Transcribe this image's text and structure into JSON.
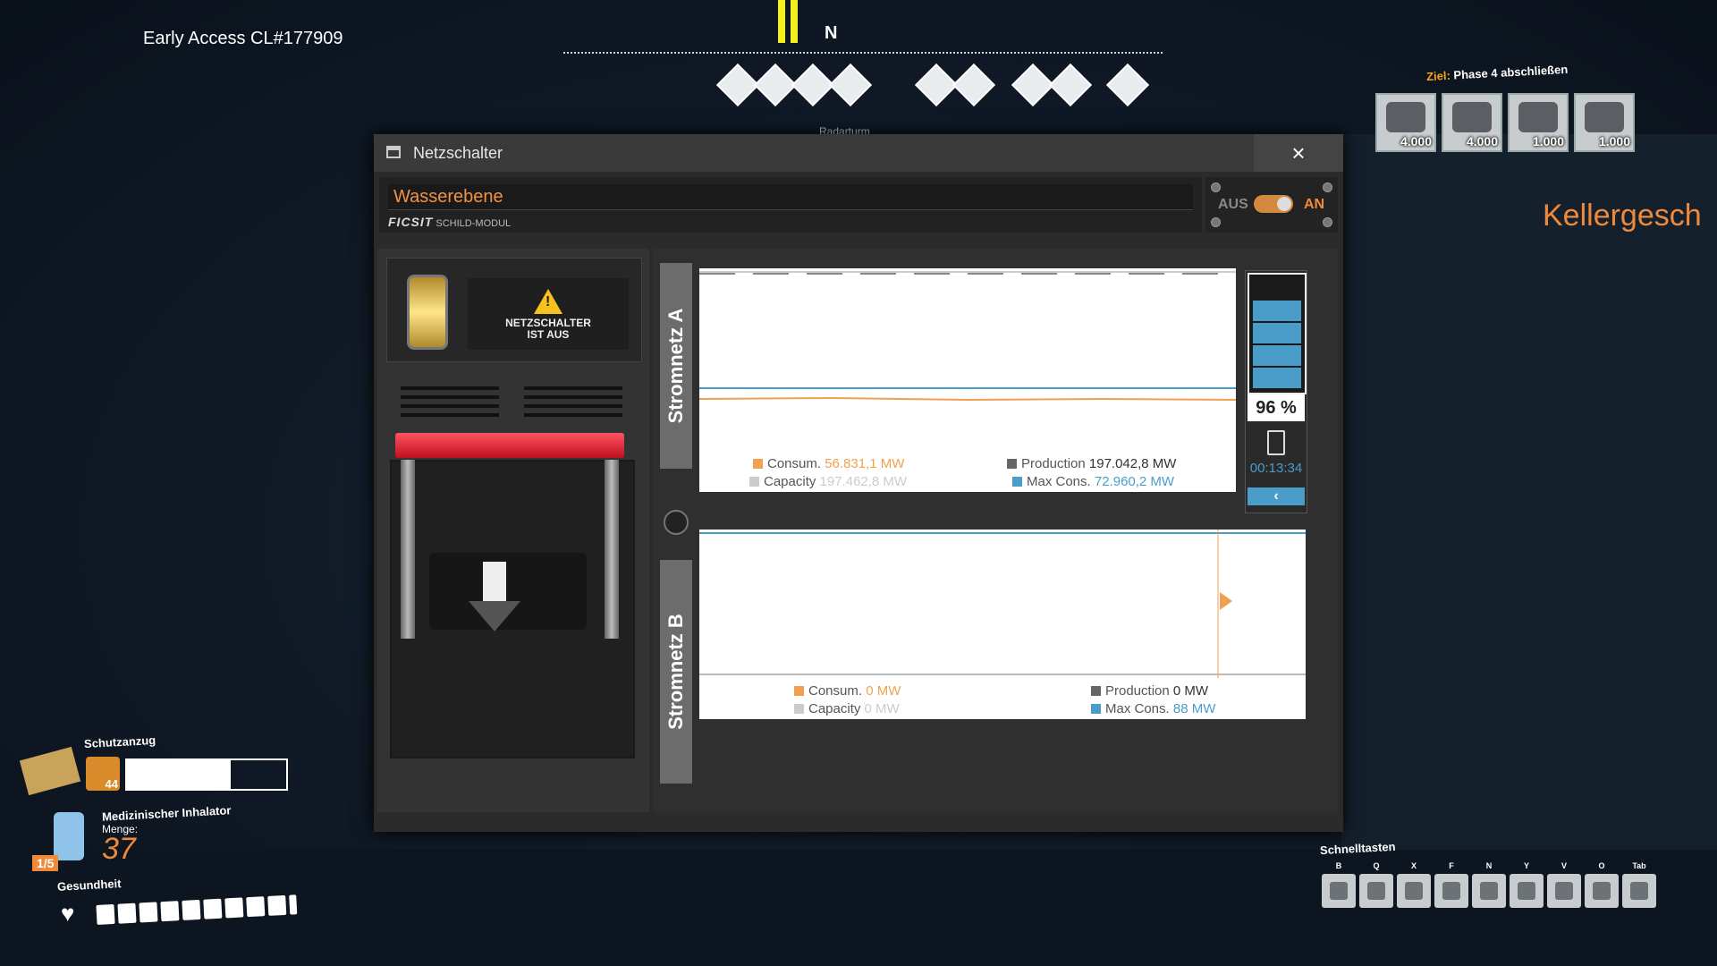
{
  "build_label": "Early Access CL#177909",
  "compass": {
    "heading": "N",
    "marker_label": "Radarturm"
  },
  "goal": {
    "prefix": "Ziel:",
    "title": "Phase 4 abschließen",
    "items": [
      {
        "icon": "motor-icon",
        "count": "4.000"
      },
      {
        "icon": "battery-module-icon",
        "count": "4.000"
      },
      {
        "icon": "computer-icon",
        "count": "1.000"
      },
      {
        "icon": "nuclear-rod-icon",
        "count": "1.000"
      }
    ]
  },
  "sign_text": "Kellergesch",
  "window": {
    "title": "Netzschalter",
    "close_label": "×",
    "name_value": "Wasserebene",
    "brand": "FICSIT",
    "module_label": "SCHILD-MODUL",
    "toggle": {
      "off_label": "AUS",
      "on_label": "AN",
      "state": "on"
    },
    "warning_line1": "NETZSCHALTER",
    "warning_line2": "IST AUS"
  },
  "circuit_a": {
    "label": "Stromnetz A",
    "consum_label": "Consum.",
    "consum_value": "56.831,1 MW",
    "production_label": "Production",
    "production_value": "197.042,8 MW",
    "capacity_label": "Capacity",
    "capacity_value": "197.462,8 MW",
    "maxcons_label": "Max Cons.",
    "maxcons_value": "72.960,2 MW",
    "battery_percent": "96 %",
    "battery_time": "00:13:34",
    "battery_button": "‹"
  },
  "circuit_b": {
    "label": "Stromnetz B",
    "consum_label": "Consum.",
    "consum_value": "0 MW",
    "production_label": "Production",
    "production_value": "0 MW",
    "capacity_label": "Capacity",
    "capacity_value": "0 MW",
    "maxcons_label": "Max Cons.",
    "maxcons_value": "88 MW"
  },
  "colors": {
    "consum": "#f0a050",
    "production": "#666666",
    "capacity": "#cccccc",
    "maxcons": "#4a9cc9"
  },
  "hud": {
    "suit_label": "Schutzanzug",
    "suit_count": "44",
    "item_label": "Medizinischer Inhalator",
    "amount_label": "Menge:",
    "amount_value": "37",
    "slot_label": "1/5",
    "health_label": "Gesundheit",
    "quick_label": "Schnelltasten",
    "quick_keys": [
      "B",
      "Q",
      "X",
      "F",
      "N",
      "Y",
      "V",
      "O",
      "Tab"
    ]
  }
}
